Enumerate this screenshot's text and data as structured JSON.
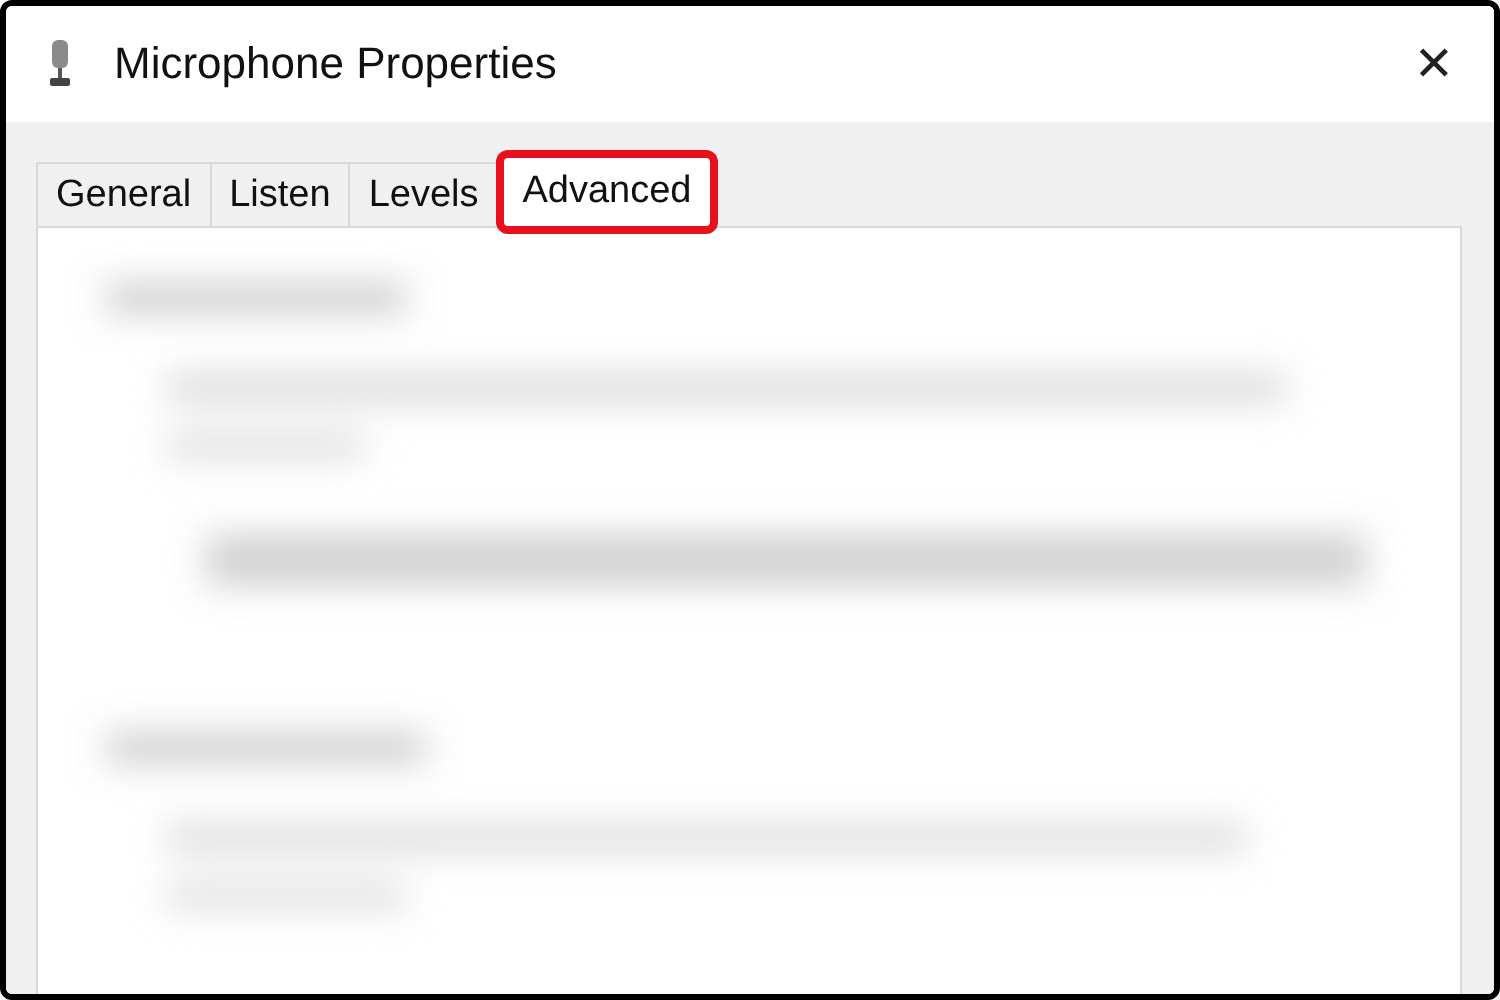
{
  "window": {
    "title": "Microphone Properties",
    "close": "✕"
  },
  "tabs": [
    {
      "label": "General",
      "selected": false,
      "highlighted": false
    },
    {
      "label": "Listen",
      "selected": false,
      "highlighted": false
    },
    {
      "label": "Levels",
      "selected": false,
      "highlighted": false
    },
    {
      "label": "Advanced",
      "selected": true,
      "highlighted": true
    }
  ]
}
